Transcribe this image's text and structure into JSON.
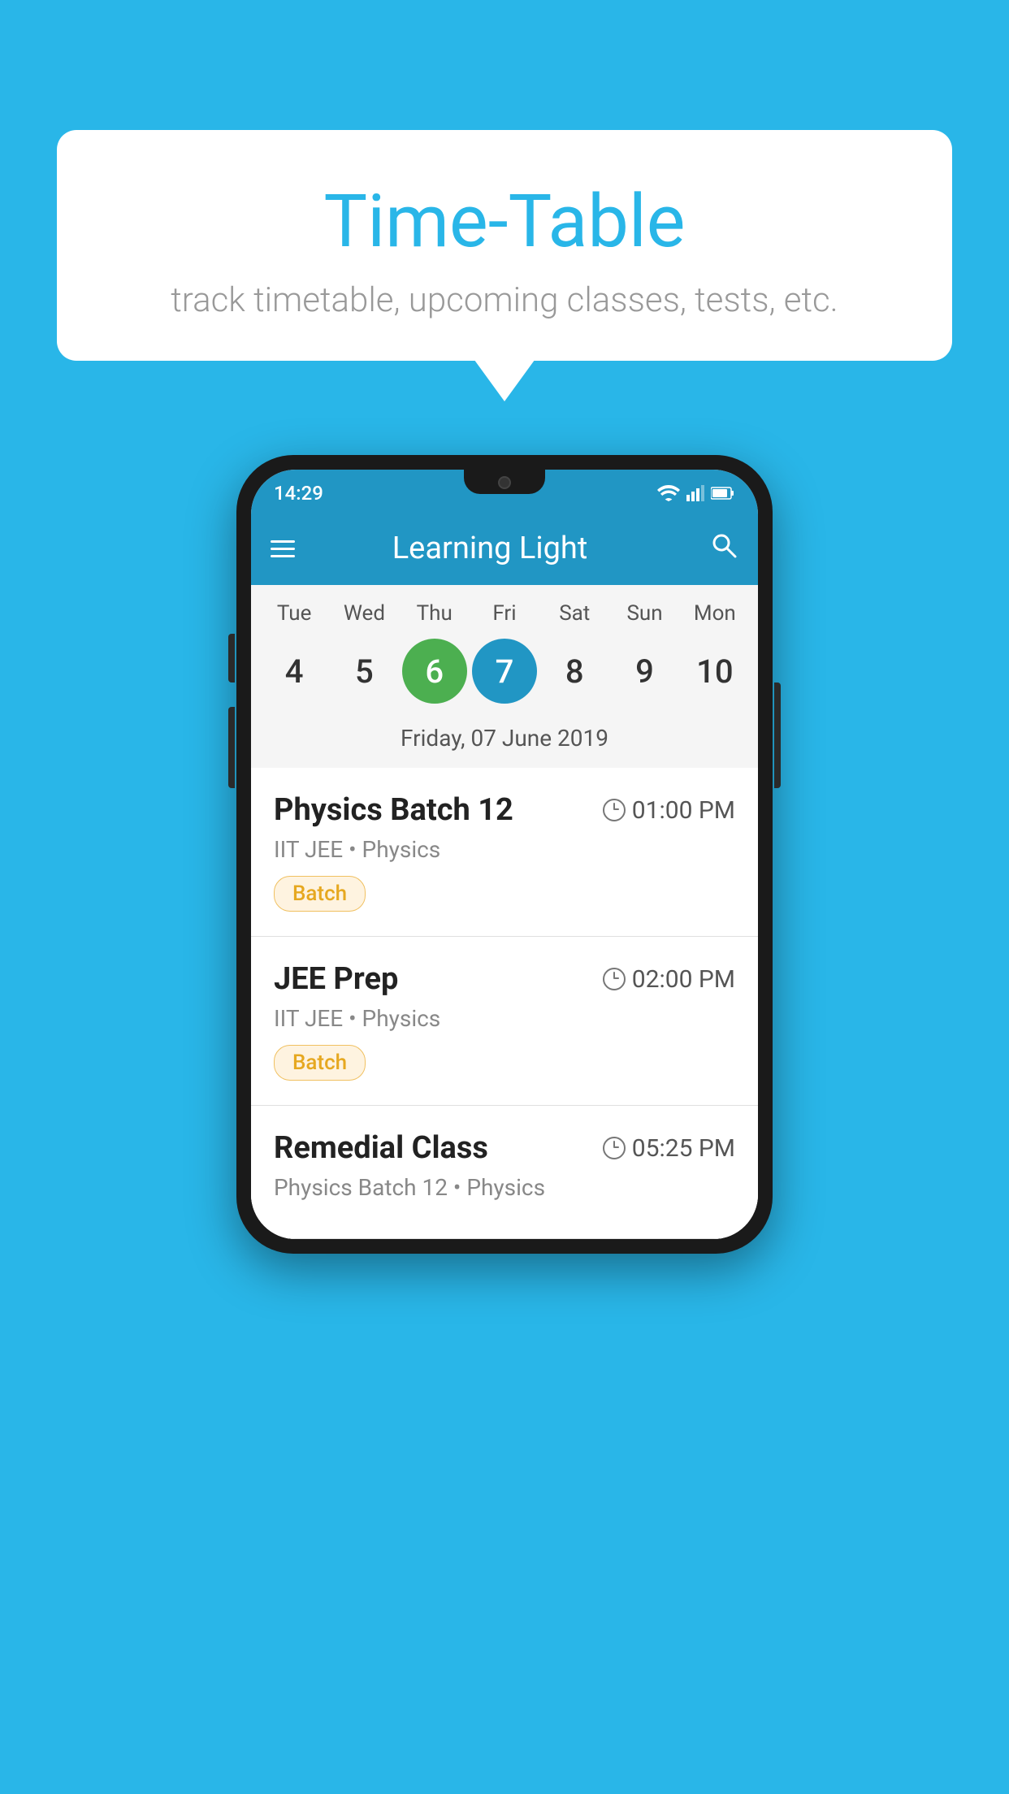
{
  "background_color": "#29b6e8",
  "header": {
    "title": "Time-Table",
    "subtitle": "track timetable, upcoming classes, tests, etc."
  },
  "status_bar": {
    "time": "14:29"
  },
  "app_bar": {
    "title": "Learning Light"
  },
  "calendar": {
    "days": [
      "Tue",
      "Wed",
      "Thu",
      "Fri",
      "Sat",
      "Sun",
      "Mon"
    ],
    "dates": [
      "4",
      "5",
      "6",
      "7",
      "8",
      "9",
      "10"
    ],
    "today_index": 2,
    "selected_index": 3,
    "selected_date_label": "Friday, 07 June 2019"
  },
  "classes": [
    {
      "name": "Physics Batch 12",
      "time": "01:00 PM",
      "subject": "IIT JEE • Physics",
      "badge": "Batch"
    },
    {
      "name": "JEE Prep",
      "time": "02:00 PM",
      "subject": "IIT JEE • Physics",
      "badge": "Batch"
    },
    {
      "name": "Remedial Class",
      "time": "05:25 PM",
      "subject": "Physics Batch 12 • Physics",
      "badge": ""
    }
  ],
  "icons": {
    "hamburger": "≡",
    "search": "🔍",
    "batch_label": "Batch"
  }
}
